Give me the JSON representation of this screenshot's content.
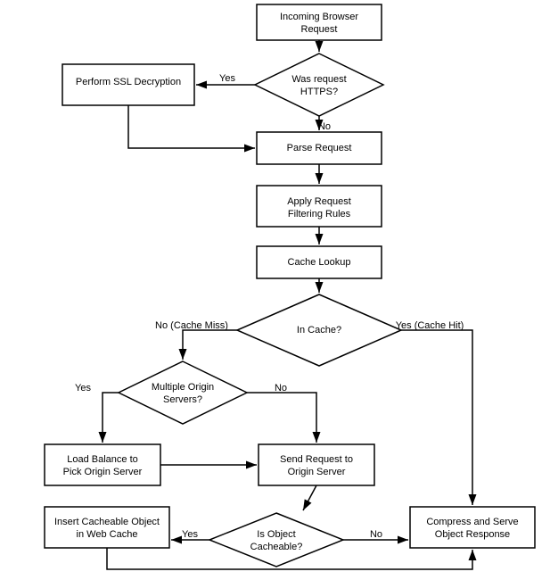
{
  "nodes": {
    "browser_request": "Incoming Browser\nRequest",
    "was_https": "Was request\nHTTPS?",
    "ssl_decrypt": "Perform SSL Decryption",
    "parse_request": "Parse Request",
    "filter_rules": "Apply Request\nFiltering Rules",
    "cache_lookup": "Cache Lookup",
    "in_cache": "In Cache?",
    "multiple_origins": "Multiple Origin\nServers?",
    "load_balance": "Load Balance to\nPick Origin Server",
    "send_request": "Send Request to\nOrigin Server",
    "is_cacheable": "Is Object\nCacheable?",
    "insert_cache": "Insert Cacheable Object\nin Web Cache",
    "compress_serve": "Compress and Serve\nObject Response"
  },
  "labels": {
    "yes": "Yes",
    "no": "No",
    "cache_miss": "No (Cache Miss)",
    "cache_hit": "Yes (Cache Hit)"
  }
}
